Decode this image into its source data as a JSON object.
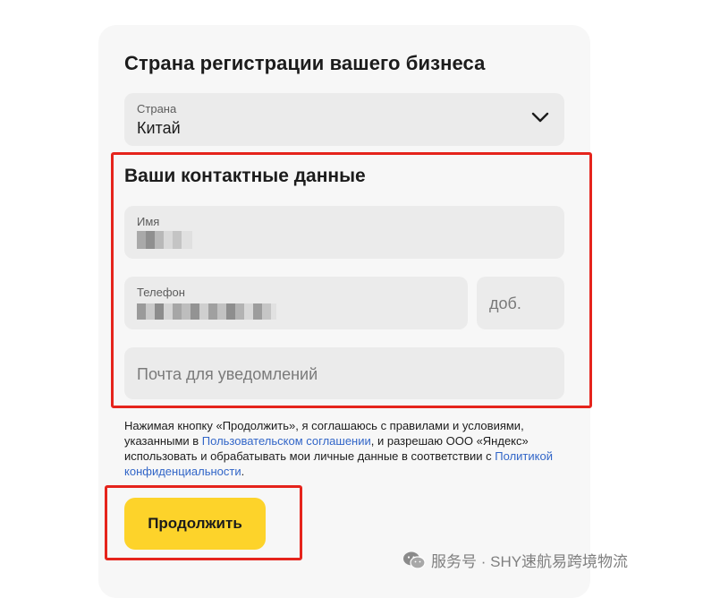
{
  "form": {
    "title": "Страна регистрации вашего бизнеса",
    "country": {
      "label": "Страна",
      "value": "Китай",
      "icon": "chevron-down-icon"
    },
    "contacts": {
      "title": "Ваши контактные данные",
      "name": {
        "label": "Имя"
      },
      "phone": {
        "label": "Телефон",
        "ext_placeholder": "доб."
      },
      "email": {
        "placeholder": "Почта для уведомлений"
      }
    },
    "consent": {
      "part1": "Нажимая кнопку «Продолжить», я соглашаюсь с правилами и условиями, указанными в ",
      "link1": "Пользовательском соглашении",
      "part2": ", и разрешаю ООО «Яндекс» использовать и обрабатывать мои личные данные в соответствии с ",
      "link2": "Политикой конфиденциальности",
      "part3": "."
    },
    "continue_label": "Продолжить"
  },
  "watermark": {
    "text": "服务号 · SHY速航易跨境物流",
    "icon": "wechat-icon"
  },
  "colors": {
    "accent_button": "#fdd32a",
    "highlight_box": "#e5241c",
    "link": "#3266c8",
    "field_bg": "#ebebeb"
  }
}
